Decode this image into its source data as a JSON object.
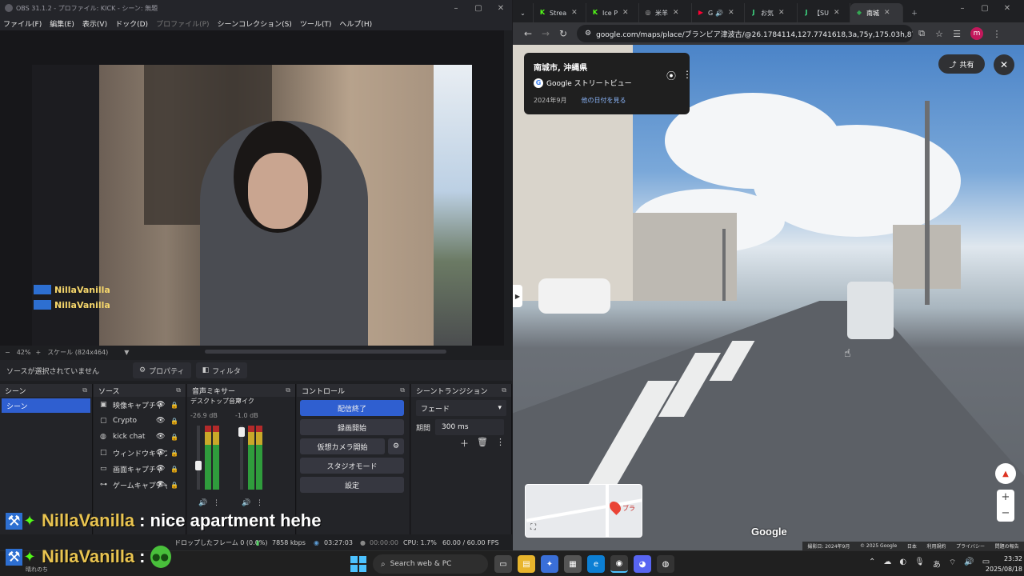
{
  "obs": {
    "title": "OBS 31.1.2 - プロファイル: KICK - シーン: 無題",
    "menu": [
      "ファイル(F)",
      "編集(E)",
      "表示(V)",
      "ドック(D)",
      "プロファイル(P)",
      "シーンコレクション(S)",
      "ツール(T)",
      "ヘルプ(H)"
    ],
    "preview_overlay_name": "NillaVanilla",
    "zoom_level": "42%",
    "scale_label": "スケール (824x464)",
    "no_source_selected": "ソースが選択されていません",
    "properties_button": "プロパティ",
    "filters_button": "フィルタ",
    "docks": {
      "scenes": {
        "title": "シーン",
        "items": [
          "シーン"
        ]
      },
      "sources": {
        "title": "ソース",
        "items": [
          {
            "label": "映像キャプチャ",
            "icon": "camera-icon"
          },
          {
            "label": "Crypto",
            "icon": "image-icon"
          },
          {
            "label": "kick chat",
            "icon": "globe-icon"
          },
          {
            "label": "ウィンドウキャプ",
            "icon": "window-icon"
          },
          {
            "label": "画面キャプチャ",
            "icon": "monitor-icon"
          },
          {
            "label": "ゲームキャプチャ",
            "icon": "gamepad-icon"
          }
        ]
      },
      "mixer": {
        "title": "音声ミキサー",
        "channels": [
          {
            "name": "デスクトップ音声",
            "db": "-26.9 dB"
          },
          {
            "name": "マイク",
            "db": "-1.0 dB"
          }
        ],
        "scale": [
          "0",
          "-5",
          "-10",
          "-15",
          "-20",
          "-25",
          "-30",
          "-35",
          "-40",
          "-45",
          "-50",
          "-55",
          "-60"
        ]
      },
      "controls": {
        "title": "コントロール",
        "buttons": [
          "配信終了",
          "録画開始",
          "仮想カメラ開始",
          "スタジオモード",
          "設定"
        ]
      },
      "transitions": {
        "title": "シーントランジション",
        "selected": "フェード",
        "duration_label": "期間",
        "duration_value": "300 ms"
      }
    },
    "status": {
      "dropped": "ドロップしたフレーム 0 (0.0%)",
      "kbps": "7858 kbps",
      "stream_time": "03:27:03",
      "rec_time": "00:00:00",
      "cpu": "CPU: 1.7%",
      "fps": "60.00 / 60.00 FPS"
    }
  },
  "chat_overlay": [
    {
      "user": "NillaVanilla",
      "message": "nice apartment hehe"
    },
    {
      "user": "NillaVanilla",
      "message": ""
    }
  ],
  "chrome": {
    "tabs": [
      {
        "label": "Strea",
        "fav": "K",
        "color": "#53fc18"
      },
      {
        "label": "Ice P",
        "fav": "K",
        "color": "#53fc18"
      },
      {
        "label": "米羊",
        "fav": "◎",
        "color": "#bbbbbb"
      },
      {
        "label": "G",
        "fav": "▶",
        "color": "#ff0033"
      },
      {
        "label": "お気",
        "fav": "J",
        "color": "#3ddc84"
      },
      {
        "label": "【SU",
        "fav": "J",
        "color": "#3ddc84"
      },
      {
        "label": "南城",
        "fav": "◆",
        "color": "#34a853",
        "active": true
      }
    ],
    "url": "google.com/maps/place/ブランビア津波古/@26.1784114,127.7741618,3a,75y,175.03h,87.05t..."
  },
  "streetview": {
    "place": "南城市, 沖縄県",
    "provider": "Google ストリートビュー",
    "capture_date": "2024年9月",
    "other_dates_link": "他の日付を見る",
    "share": "共有",
    "minimap_label": "ブラ",
    "watermark": "Google",
    "footer": [
      "撮影日: 2024年9月",
      "© 2025 Google",
      "日本",
      "利用規約",
      "プライバシー",
      "問題の報告"
    ]
  },
  "taskbar": {
    "weather": "晴れのち",
    "search_placeholder": "Search web & PC",
    "ime": "あ",
    "time": "23:32",
    "date": "2025/08/18"
  }
}
